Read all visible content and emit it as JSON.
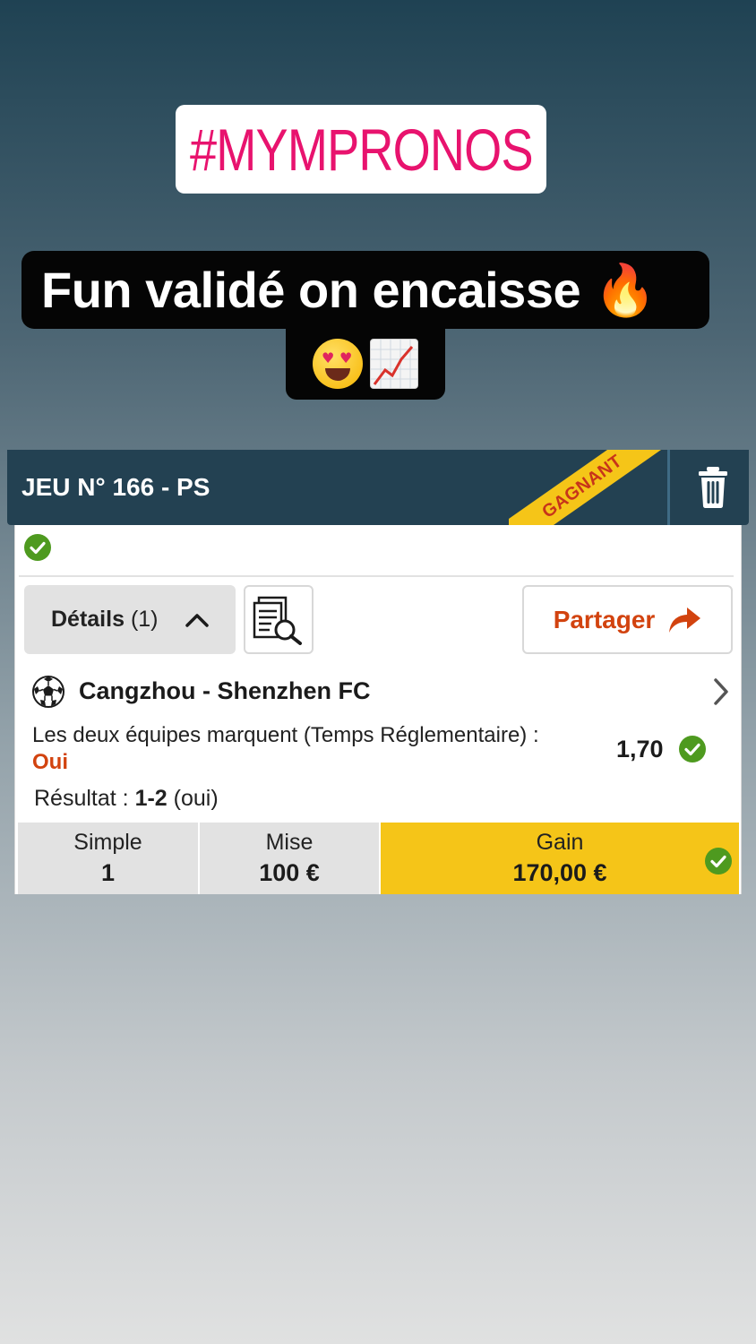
{
  "story": {
    "hashtag": "#MYMPRONOS",
    "caption": "Fun validé on encaisse 🔥",
    "emojis": [
      "smiling-face-with-heart-eyes",
      "chart-increasing"
    ]
  },
  "bet_card": {
    "header": {
      "title": "JEU N° 166 - PS",
      "ribbon": "GAGNANT",
      "trash_icon": "trash-icon"
    },
    "status_icon": "check-circle-icon",
    "actions": {
      "details_label": "Détails",
      "details_count": "(1)",
      "share_label": "Partager"
    },
    "selection": {
      "match": "Cangzhou - Shenzhen FC",
      "market": "Les deux équipes marquent (Temps Réglementaire) :",
      "choice": "Oui",
      "odds": "1,70",
      "result_label": "Résultat :",
      "result_score": "1-2",
      "result_suffix": "(oui)"
    },
    "footer": {
      "type_label": "Simple",
      "type_value": "1",
      "stake_label": "Mise",
      "stake_value": "100 €",
      "gain_label": "Gain",
      "gain_value": "170,00 €"
    }
  },
  "colors": {
    "header_bg": "#234152",
    "ribbon": "#f5c518",
    "accent_orange": "#d2430f",
    "success_green": "#4e9a1f",
    "hashtag_pink": "#e8136e"
  }
}
